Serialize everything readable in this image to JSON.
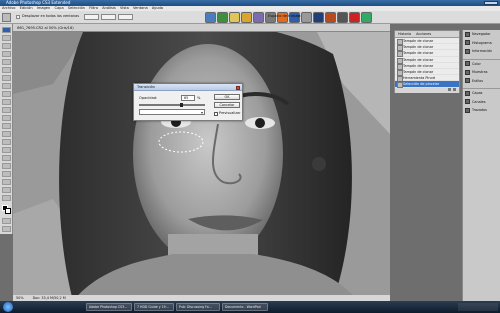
{
  "app": {
    "title": "Adobe Photoshop CS3 Extended"
  },
  "menu": [
    "Archivo",
    "Edición",
    "Imagen",
    "Capa",
    "Selección",
    "Filtro",
    "Análisis",
    "Vista",
    "Ventana",
    "Ayuda"
  ],
  "options_bar": {
    "checkbox_label": "Desplazar en todas las ventanas",
    "workspace_label": "Espacio de trabajo"
  },
  "document": {
    "title": "IMG_7695.CR2 al 50% (Gris/16)"
  },
  "history_panel": {
    "tabs": [
      "Historia",
      "Acciones"
    ],
    "items": [
      {
        "label": "Tampón de clonar"
      },
      {
        "label": "Tampón de clonar"
      },
      {
        "label": "Tampón de clonar"
      },
      {
        "label": "Tampón de clonar"
      },
      {
        "label": "Tampón de clonar"
      },
      {
        "label": "Tampón de clonar"
      },
      {
        "label": "Herramienta Pincel"
      },
      {
        "label": "Selección de pincelar"
      }
    ]
  },
  "side_panels": {
    "group1": [
      "Navegador",
      "Histograma",
      "Información"
    ],
    "group2": [
      "Color",
      "Muestras",
      "Estilos"
    ],
    "group3": [
      "Capas",
      "Canales",
      "Trazados"
    ]
  },
  "dialog": {
    "title": "Transición",
    "opacity_label": "Opacidad:",
    "opacity_value": "65",
    "opacity_unit": "%",
    "ok": "OK",
    "cancel": "Cancelar",
    "preview_label": "Previsualizar",
    "slider_fraction": 0.65
  },
  "status": {
    "zoom": "50%",
    "doc_info": "Doc: 33,4 M/50,2 M"
  },
  "taskbar": {
    "items": [
      "Adobe Photoshop CS3...",
      "7 HDD Guide y 19...",
      "Pub: Discussing Fo...",
      "Documento - WordPad"
    ]
  }
}
